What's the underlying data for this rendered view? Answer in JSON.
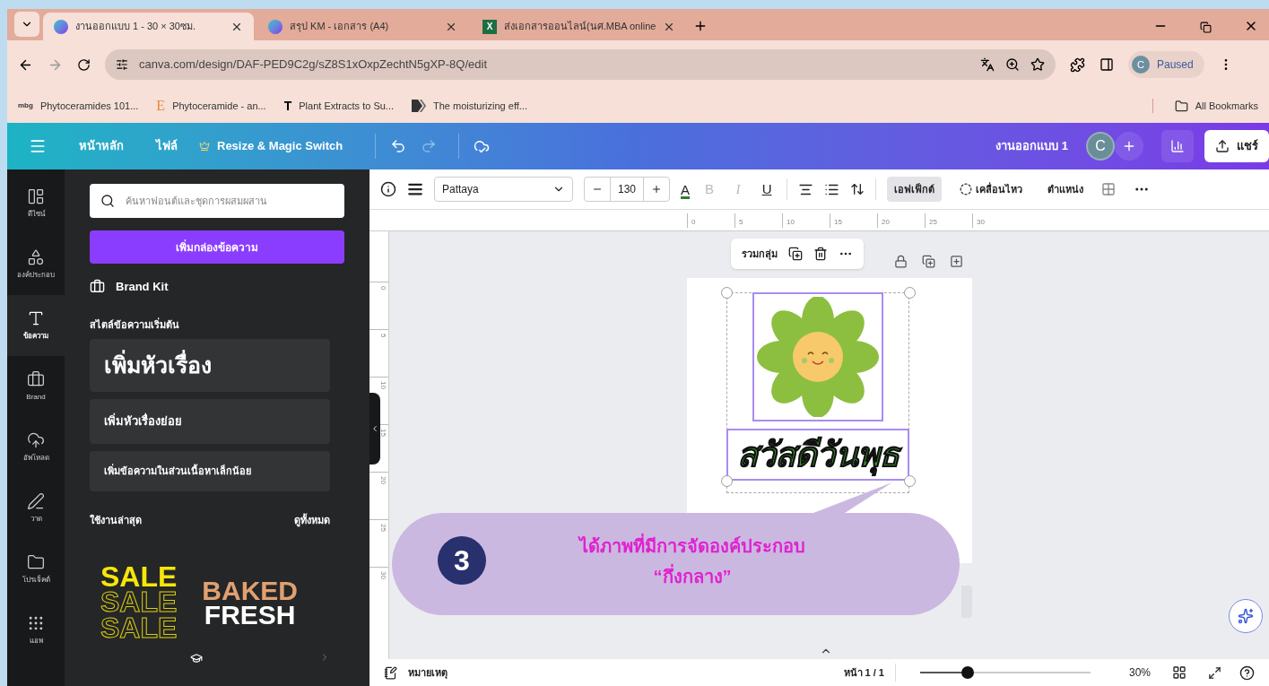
{
  "browser": {
    "tabs": [
      {
        "title": "งานออกแบบ 1 - 30 × 30ซม.",
        "selected": true,
        "kind": "canva"
      },
      {
        "title": "สรุป KM - เอกสาร (A4)",
        "selected": false,
        "kind": "canva"
      },
      {
        "title": "ส่งเอกสารออนไลน์(นศ.MBA online",
        "selected": false,
        "kind": "excel",
        "icon_text": "X"
      }
    ],
    "url": "canva.com/design/DAF-PED9C2g/sZ8S1xOxpZechtN5gXP-8Q/edit",
    "profile": {
      "initial": "C",
      "status": "Paused"
    },
    "bookmarks": [
      {
        "label": "Phytoceramides 101...",
        "kind": "text",
        "icon_text": "mbg"
      },
      {
        "label": "Phytoceramide - an...",
        "kind": "serif",
        "icon_text": "E"
      },
      {
        "label": "Plant Extracts to Su...",
        "kind": "bold",
        "icon_text": "T"
      },
      {
        "label": "The moisturizing eff...",
        "kind": "shape"
      }
    ],
    "all_bookmarks": "All Bookmarks"
  },
  "header": {
    "menu": [
      "หน้าหลัก",
      "ไฟล์"
    ],
    "resize": "Resize & Magic Switch",
    "design_title": "งานออกแบบ 1",
    "avatar": "C",
    "share": "แชร์"
  },
  "rail": [
    {
      "label": "ดีไซน์",
      "selected": false
    },
    {
      "label": "องค์ประกอบ",
      "selected": false
    },
    {
      "label": "ข้อความ",
      "selected": true
    },
    {
      "label": "Brand",
      "selected": false
    },
    {
      "label": "อัพโหลด",
      "selected": false
    },
    {
      "label": "วาด",
      "selected": false
    },
    {
      "label": "โปรเจ็คต์",
      "selected": false
    },
    {
      "label": "แอพ",
      "selected": false
    }
  ],
  "panel": {
    "search_placeholder": "ค้นหาฟอนต์และชุดการผสมผสาน",
    "add_button": "เพิ่มกล่องข้อความ",
    "brand_kit": "Brand Kit",
    "section_title": "สไตล์ข้อความเริ่มต้น",
    "styles": [
      {
        "label": "เพิ่มหัวเรื่อง",
        "kind": "heading"
      },
      {
        "label": "เพิ่มหัวเรื่องย่อย",
        "kind": "subheading"
      },
      {
        "label": "เพิ่มข้อความในส่วนเนื้อหาเล็กน้อย",
        "kind": "body"
      }
    ],
    "recent_title": "ใช้งานล่าสุด",
    "see_all": "ดูทั้งหมด",
    "previews": [
      {
        "kind": "sale",
        "lines": [
          "SALE",
          "SALE",
          "SALE"
        ]
      },
      {
        "kind": "baked",
        "lines": [
          "BAKED",
          "FRESH"
        ]
      }
    ]
  },
  "toolbar": {
    "font": "Pattaya",
    "size": "130",
    "text_color": "A",
    "format": [
      {
        "label": "B",
        "disabled": true
      },
      {
        "label": "I",
        "disabled": true
      },
      {
        "label": "U",
        "disabled": false
      }
    ],
    "buttons": [
      {
        "label": "เอฟเฟ็กต์",
        "selected": true
      },
      {
        "label": "เคลื่อนไหว",
        "selected": false
      },
      {
        "label": "ตำแหน่ง",
        "selected": false
      }
    ]
  },
  "ruler": [
    "0",
    "5",
    "10",
    "15",
    "20",
    "25",
    "30"
  ],
  "vertical_ruler": [
    "0",
    "5",
    "10",
    "15",
    "20",
    "25",
    "30"
  ],
  "selection_toolbar": {
    "group": "รวมกลุ่ม"
  },
  "page": {
    "text": "สวัสดีวันพุธ"
  },
  "callout": {
    "number": "3",
    "lines": [
      "ได้ภาพที่มีการจัดองค์ประกอบ",
      "“กึ่งกลาง”"
    ]
  },
  "footer": {
    "notes": "หมายเหตุ",
    "page": "หน้า 1 / 1",
    "zoom": {
      "level": 0.28,
      "reading": "30%"
    }
  }
}
